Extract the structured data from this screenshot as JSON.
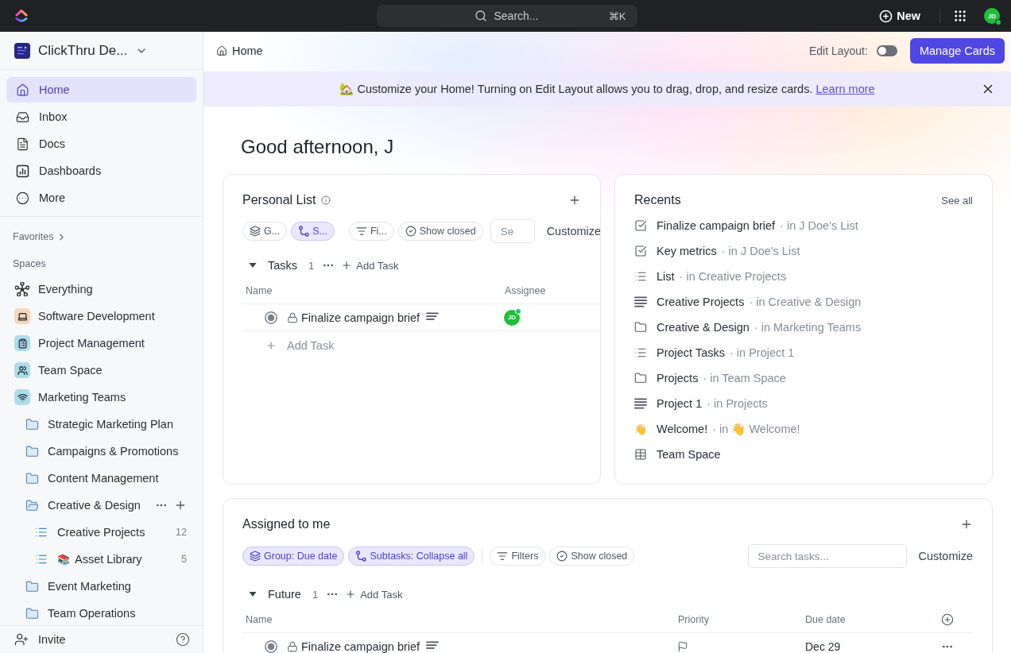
{
  "top_bar": {
    "search": {
      "placeholder": "Search...",
      "shortcut": "⌘K"
    },
    "new_button": "New",
    "avatar": {
      "initials": "JD",
      "online": true
    }
  },
  "sidebar": {
    "workspace": "ClickThru De...",
    "nav": [
      {
        "kind": "home",
        "label": "Home",
        "selected": true
      },
      {
        "kind": "inbox",
        "label": "Inbox",
        "selected": false
      },
      {
        "kind": "docs",
        "label": "Docs",
        "selected": false
      },
      {
        "kind": "dashboards",
        "label": "Dashboards",
        "selected": false
      },
      {
        "kind": "more",
        "label": "More",
        "selected": false
      }
    ],
    "favorites": "Favorites",
    "spaces_heading": "Spaces",
    "spaces": [
      {
        "kind": "everything",
        "label": "Everything"
      },
      {
        "kind": "space",
        "label": "Software Development",
        "color": "#f6d7bb"
      },
      {
        "kind": "space",
        "label": "Project Management",
        "color": "#addcea"
      },
      {
        "kind": "space",
        "label": "Team Space",
        "color": "#addcea"
      },
      {
        "kind": "space",
        "label": "Marketing Teams",
        "color": "#addcea",
        "children": [
          {
            "kind": "folder",
            "label": "Strategic Marketing Plan",
            "expanded": false,
            "hovered": false
          },
          {
            "kind": "folder",
            "label": "Campaigns & Promotions",
            "expanded": false,
            "hovered": false
          },
          {
            "kind": "folder",
            "label": "Content Management",
            "expanded": false,
            "hovered": false
          },
          {
            "kind": "folder",
            "label": "Creative & Design",
            "expanded": true,
            "hovered": true,
            "children": [
              {
                "kind": "list",
                "label": "Creative Projects",
                "count": "12"
              },
              {
                "kind": "list",
                "label": "Asset Library",
                "emoji": "📚",
                "count": "5"
              }
            ]
          },
          {
            "kind": "folder",
            "label": "Event Marketing",
            "expanded": false,
            "hovered": false
          },
          {
            "kind": "folder",
            "label": "Team Operations",
            "expanded": false,
            "hovered": false
          }
        ]
      }
    ],
    "invite": "Invite"
  },
  "header": {
    "breadcrumb": "Home",
    "edit_layout": {
      "label": "Edit Layout:",
      "on": false
    },
    "manage_button": "Manage Cards"
  },
  "banner": {
    "text": "🏡 Customize your Home! Turning on Edit Layout allows you to drag, drop, and resize cards.",
    "link": "Learn more"
  },
  "greeting": "Good afternoon, J",
  "personal_list": {
    "title": "Personal List",
    "chips": [
      {
        "kind": "group",
        "label": "G...",
        "selected": false
      },
      {
        "kind": "subtasks",
        "label": "S...",
        "selected": true
      },
      {
        "kind": "filters",
        "label": "Fi...",
        "selected": false
      },
      {
        "kind": "closed",
        "label": "Show closed",
        "selected": false
      }
    ],
    "search": {
      "placeholder": "Se"
    },
    "customize": "Customize",
    "group": {
      "name": "Tasks",
      "count": "1",
      "expanded": true,
      "add": "Add Task"
    },
    "columns": [
      "Name",
      "Assignee"
    ],
    "rows": [
      {
        "name": "Finalize campaign brief",
        "assignee": {
          "initials": "JD",
          "online": true
        }
      }
    ],
    "add_task": "Add Task"
  },
  "recents": {
    "title": "Recents",
    "see_all": "See all",
    "items": [
      {
        "kind": "task",
        "name": "Finalize campaign brief",
        "location": "· in J Doe's List"
      },
      {
        "kind": "task",
        "name": "Key metrics",
        "location": "· in J Doe's List"
      },
      {
        "kind": "list",
        "name": "List",
        "location": "· in Creative Projects"
      },
      {
        "kind": "doc",
        "name": "Creative Projects",
        "location": "· in Creative & Design"
      },
      {
        "kind": "folder",
        "name": "Creative & Design",
        "location": "· in Marketing Teams"
      },
      {
        "kind": "list",
        "name": "Project Tasks",
        "location": "· in Project 1"
      },
      {
        "kind": "folder",
        "name": "Projects",
        "location": "· in Team Space"
      },
      {
        "kind": "doc",
        "name": "Project 1",
        "location": "· in Projects"
      },
      {
        "kind": "emoji",
        "emoji": "👋",
        "name": "Welcome!",
        "location": "· in 👋 Welcome!"
      },
      {
        "kind": "table",
        "name": "Team Space"
      }
    ]
  },
  "assigned_to_me": {
    "title": "Assigned to me",
    "chips": [
      {
        "kind": "group",
        "label": "Group: Due date",
        "selected": true
      },
      {
        "kind": "subtasks",
        "label": "Subtasks: Collapse all",
        "selected": true
      },
      {
        "kind": "filters",
        "label": "Filters",
        "selected": false
      },
      {
        "kind": "closed",
        "label": "Show closed",
        "selected": false
      }
    ],
    "search": {
      "placeholder": "Search tasks..."
    },
    "customize": "Customize",
    "group": {
      "name": "Future",
      "count": "1",
      "expanded": true,
      "add": "Add Task"
    },
    "columns": [
      "Name",
      "Priority",
      "Due date"
    ],
    "rows": [
      {
        "name": "Finalize campaign brief",
        "due_date": "Dec 29"
      }
    ]
  }
}
